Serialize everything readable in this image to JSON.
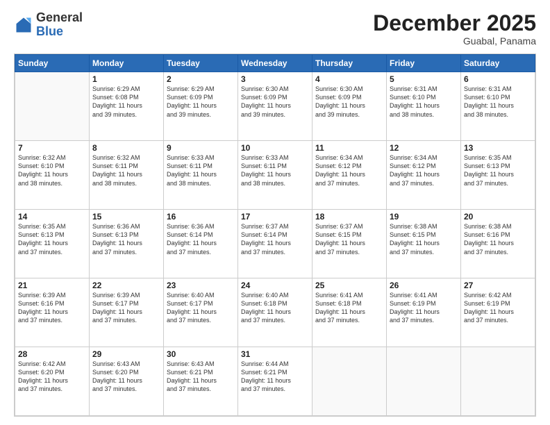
{
  "logo": {
    "general": "General",
    "blue": "Blue"
  },
  "header": {
    "title": "December 2025",
    "subtitle": "Guabal, Panama"
  },
  "days_of_week": [
    "Sunday",
    "Monday",
    "Tuesday",
    "Wednesday",
    "Thursday",
    "Friday",
    "Saturday"
  ],
  "weeks": [
    [
      {
        "day": "",
        "info": ""
      },
      {
        "day": "1",
        "info": "Sunrise: 6:29 AM\nSunset: 6:08 PM\nDaylight: 11 hours\nand 39 minutes."
      },
      {
        "day": "2",
        "info": "Sunrise: 6:29 AM\nSunset: 6:09 PM\nDaylight: 11 hours\nand 39 minutes."
      },
      {
        "day": "3",
        "info": "Sunrise: 6:30 AM\nSunset: 6:09 PM\nDaylight: 11 hours\nand 39 minutes."
      },
      {
        "day": "4",
        "info": "Sunrise: 6:30 AM\nSunset: 6:09 PM\nDaylight: 11 hours\nand 39 minutes."
      },
      {
        "day": "5",
        "info": "Sunrise: 6:31 AM\nSunset: 6:10 PM\nDaylight: 11 hours\nand 38 minutes."
      },
      {
        "day": "6",
        "info": "Sunrise: 6:31 AM\nSunset: 6:10 PM\nDaylight: 11 hours\nand 38 minutes."
      }
    ],
    [
      {
        "day": "7",
        "info": "Sunrise: 6:32 AM\nSunset: 6:10 PM\nDaylight: 11 hours\nand 38 minutes."
      },
      {
        "day": "8",
        "info": "Sunrise: 6:32 AM\nSunset: 6:11 PM\nDaylight: 11 hours\nand 38 minutes."
      },
      {
        "day": "9",
        "info": "Sunrise: 6:33 AM\nSunset: 6:11 PM\nDaylight: 11 hours\nand 38 minutes."
      },
      {
        "day": "10",
        "info": "Sunrise: 6:33 AM\nSunset: 6:11 PM\nDaylight: 11 hours\nand 38 minutes."
      },
      {
        "day": "11",
        "info": "Sunrise: 6:34 AM\nSunset: 6:12 PM\nDaylight: 11 hours\nand 37 minutes."
      },
      {
        "day": "12",
        "info": "Sunrise: 6:34 AM\nSunset: 6:12 PM\nDaylight: 11 hours\nand 37 minutes."
      },
      {
        "day": "13",
        "info": "Sunrise: 6:35 AM\nSunset: 6:13 PM\nDaylight: 11 hours\nand 37 minutes."
      }
    ],
    [
      {
        "day": "14",
        "info": "Sunrise: 6:35 AM\nSunset: 6:13 PM\nDaylight: 11 hours\nand 37 minutes."
      },
      {
        "day": "15",
        "info": "Sunrise: 6:36 AM\nSunset: 6:13 PM\nDaylight: 11 hours\nand 37 minutes."
      },
      {
        "day": "16",
        "info": "Sunrise: 6:36 AM\nSunset: 6:14 PM\nDaylight: 11 hours\nand 37 minutes."
      },
      {
        "day": "17",
        "info": "Sunrise: 6:37 AM\nSunset: 6:14 PM\nDaylight: 11 hours\nand 37 minutes."
      },
      {
        "day": "18",
        "info": "Sunrise: 6:37 AM\nSunset: 6:15 PM\nDaylight: 11 hours\nand 37 minutes."
      },
      {
        "day": "19",
        "info": "Sunrise: 6:38 AM\nSunset: 6:15 PM\nDaylight: 11 hours\nand 37 minutes."
      },
      {
        "day": "20",
        "info": "Sunrise: 6:38 AM\nSunset: 6:16 PM\nDaylight: 11 hours\nand 37 minutes."
      }
    ],
    [
      {
        "day": "21",
        "info": "Sunrise: 6:39 AM\nSunset: 6:16 PM\nDaylight: 11 hours\nand 37 minutes."
      },
      {
        "day": "22",
        "info": "Sunrise: 6:39 AM\nSunset: 6:17 PM\nDaylight: 11 hours\nand 37 minutes."
      },
      {
        "day": "23",
        "info": "Sunrise: 6:40 AM\nSunset: 6:17 PM\nDaylight: 11 hours\nand 37 minutes."
      },
      {
        "day": "24",
        "info": "Sunrise: 6:40 AM\nSunset: 6:18 PM\nDaylight: 11 hours\nand 37 minutes."
      },
      {
        "day": "25",
        "info": "Sunrise: 6:41 AM\nSunset: 6:18 PM\nDaylight: 11 hours\nand 37 minutes."
      },
      {
        "day": "26",
        "info": "Sunrise: 6:41 AM\nSunset: 6:19 PM\nDaylight: 11 hours\nand 37 minutes."
      },
      {
        "day": "27",
        "info": "Sunrise: 6:42 AM\nSunset: 6:19 PM\nDaylight: 11 hours\nand 37 minutes."
      }
    ],
    [
      {
        "day": "28",
        "info": "Sunrise: 6:42 AM\nSunset: 6:20 PM\nDaylight: 11 hours\nand 37 minutes."
      },
      {
        "day": "29",
        "info": "Sunrise: 6:43 AM\nSunset: 6:20 PM\nDaylight: 11 hours\nand 37 minutes."
      },
      {
        "day": "30",
        "info": "Sunrise: 6:43 AM\nSunset: 6:21 PM\nDaylight: 11 hours\nand 37 minutes."
      },
      {
        "day": "31",
        "info": "Sunrise: 6:44 AM\nSunset: 6:21 PM\nDaylight: 11 hours\nand 37 minutes."
      },
      {
        "day": "",
        "info": ""
      },
      {
        "day": "",
        "info": ""
      },
      {
        "day": "",
        "info": ""
      }
    ]
  ]
}
